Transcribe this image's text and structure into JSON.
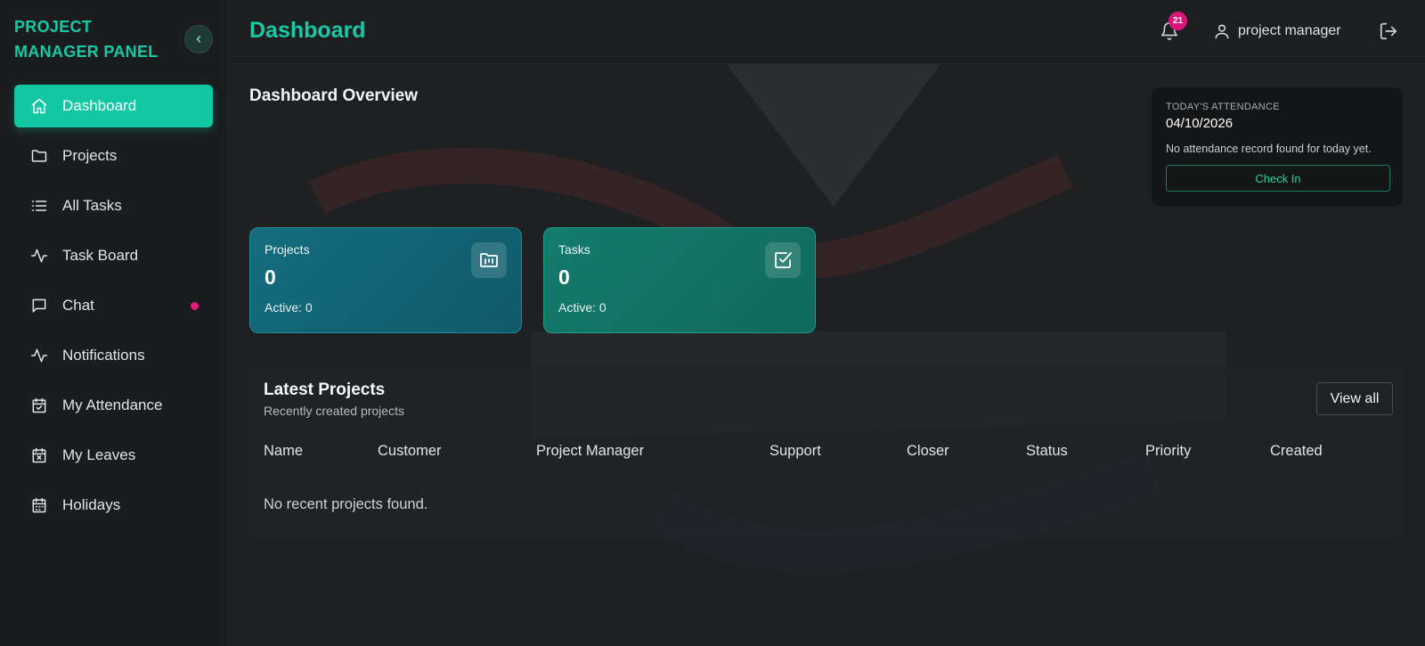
{
  "sidebar": {
    "brand": "PROJECT MANAGER PANEL",
    "items": [
      {
        "label": "Dashboard",
        "icon": "home-icon",
        "active": true
      },
      {
        "label": "Projects",
        "icon": "folder-icon"
      },
      {
        "label": "All Tasks",
        "icon": "list-icon"
      },
      {
        "label": "Task Board",
        "icon": "activity-icon"
      },
      {
        "label": "Chat",
        "icon": "chat-icon"
      },
      {
        "label": "Notifications",
        "icon": "activity-icon"
      },
      {
        "label": "My Attendance",
        "icon": "calendar-check-icon"
      },
      {
        "label": "My Leaves",
        "icon": "calendar-x-icon"
      },
      {
        "label": "Holidays",
        "icon": "calendar-icon"
      }
    ]
  },
  "header": {
    "title": "Dashboard",
    "notification_count": "21",
    "user_name": "project manager"
  },
  "main": {
    "overview_title": "Dashboard Overview",
    "attendance": {
      "label": "TODAY'S ATTENDANCE",
      "date": "04/10/2026",
      "message": "No attendance record found for today yet.",
      "button": "Check In"
    },
    "stats": {
      "projects": {
        "label": "Projects",
        "value": "0",
        "active": "Active: 0"
      },
      "tasks": {
        "label": "Tasks",
        "value": "0",
        "active": "Active: 0"
      }
    },
    "latest": {
      "title": "Latest Projects",
      "subtitle": "Recently created projects",
      "view_all": "View all",
      "columns": [
        "Name",
        "Customer",
        "Project Manager",
        "Support",
        "Closer",
        "Status",
        "Priority",
        "Created"
      ],
      "empty": "No recent projects found."
    }
  },
  "colors": {
    "accent": "#12c7a4",
    "badge": "#d8177a",
    "projects_card": "#146d7e",
    "tasks_card": "#147b6c"
  }
}
